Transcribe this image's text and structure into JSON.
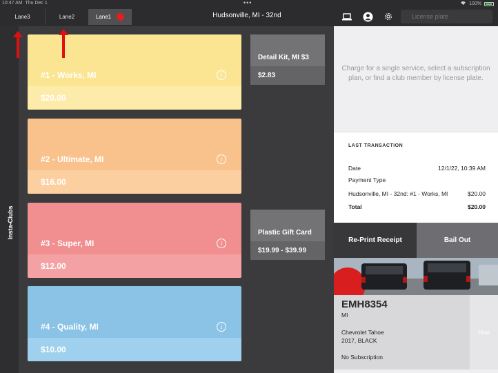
{
  "status": {
    "time": "10:47 AM",
    "date": "Thu Dec 1",
    "battery": "100%"
  },
  "tabs": [
    {
      "label": "Lane3"
    },
    {
      "label": "Lane2"
    },
    {
      "label": "Lane1"
    }
  ],
  "header": {
    "location": "Hudsonville, MI - 32nd"
  },
  "search": {
    "placeholder": "License plate"
  },
  "sidebar": {
    "label": "Insta-Clubs"
  },
  "services": [
    {
      "name": "#1 - Works, MI",
      "price": "$20.00",
      "color": "#fbe593"
    },
    {
      "name": "#2 - Ultimate, MI",
      "price": "$16.00",
      "color": "#f9c18c"
    },
    {
      "name": "#3 - Super, MI",
      "price": "$12.00",
      "color": "#f08e90"
    },
    {
      "name": "#4 - Quality, MI",
      "price": "$10.00",
      "color": "#8ac3e6"
    }
  ],
  "products": [
    {
      "name": "Detail Kit, MI  $3",
      "price": "$2.83"
    },
    {
      "name": "Plastic Gift Card",
      "price": "$19.99 - $39.99"
    }
  ],
  "panel": {
    "hint": "Charge for a single service, select a subscription plan, or find a club member by license plate.",
    "last_transaction": {
      "title": "LAST TRANSACTION",
      "date_label": "Date",
      "date_value": "12/1/22, 10:39 AM",
      "payment_label": "Payment Type",
      "payment_value": "",
      "item_label": "Hudsonville, MI - 32nd: #1 - Works, MI",
      "item_value": "$20.00",
      "total_label": "Total",
      "total_value": "$20.00"
    },
    "reprint_label": "Re-Print Receipt",
    "bailout_label": "Bail Out"
  },
  "vehicle": {
    "plate": "EMH8354",
    "state": "MI",
    "model": "Chevrolet Tahoe",
    "year_color": "2017, BLACK",
    "subscription": "No Subscription",
    "hide_label": "Hide"
  },
  "colors": {
    "accent_red": "#e02020",
    "dark_bg": "#3b3b3d"
  }
}
